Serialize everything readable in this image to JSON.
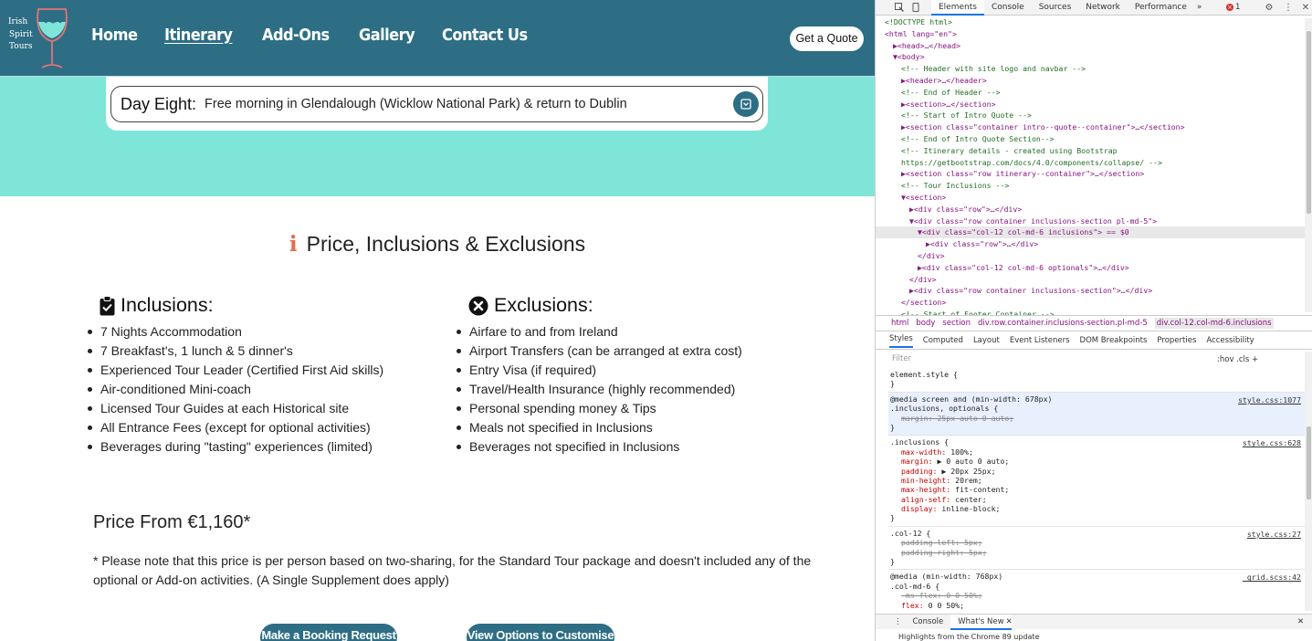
{
  "site": {
    "logo": {
      "line1": "Irish",
      "line2": "Spirit",
      "line3": "Tours"
    },
    "nav": [
      "Home",
      "Itinerary",
      "Add-Ons",
      "Gallery",
      "Contact Us"
    ],
    "quote_button": "Get a Quote",
    "day": {
      "title": "Day Eight:",
      "text": "Free morning in Glendalough (Wicklow National Park) & return to Dublin"
    },
    "section_title": "Price, Inclusions & Exclusions",
    "section_icon": "info-icon",
    "inclusions": {
      "heading": "Inclusions:",
      "icon": "clipboard-check-icon",
      "items": [
        "7 Nights Accommodation",
        "7 Breakfast's, 1 lunch & 5 dinner's",
        "Experienced Tour Leader (Certified First Aid skills)",
        "Air-conditioned Mini-coach",
        "Licensed Tour Guides at each Historical site",
        "All Entrance Fees (except for optional activities)",
        "Beverages during \"tasting\" experiences (limited)"
      ]
    },
    "exclusions": {
      "heading": "Exclusions:",
      "icon": "times-circle-icon",
      "items": [
        "Airfare to and from Ireland",
        "Airport Transfers (can be arranged at extra cost)",
        "Entry Visa (if required)",
        "Travel/Health Insurance (highly recommended)",
        "Personal spending money & Tips",
        "Meals not specified in Inclusions",
        "Beverages not specified in Inclusions"
      ]
    },
    "price": {
      "label": "Price From ",
      "amount": "€1,160*"
    },
    "price_note": "* Please note that this price is per person based on two-sharing, for the Standard Tour package and doesn't included any of the optional or Add-on activities. (A Single Supplement does apply)",
    "cta": [
      "Make a Booking Request",
      "View Options to Customise"
    ],
    "colors": {
      "header": "#2d6e85",
      "band": "#7fe5d8",
      "accent": "#e96a4b"
    }
  },
  "devtools": {
    "tabs": [
      "Elements",
      "Console",
      "Sources",
      "Network",
      "Performance"
    ],
    "more": "»",
    "error_count": "1",
    "dom_lines": [
      {
        "t": "<!DOCTYPE html>",
        "k": "cm",
        "i": 0
      },
      {
        "t": "<html lang=\"en\">",
        "k": "tag",
        "i": 0
      },
      {
        "t": "▶<head>…</head>",
        "k": "tag",
        "i": 1
      },
      {
        "t": "▼<body>",
        "k": "tag",
        "i": 1
      },
      {
        "t": "<!-- Header with site logo and navbar -->",
        "k": "cm",
        "i": 2
      },
      {
        "t": "▶<header>…</header>",
        "k": "tag",
        "i": 2
      },
      {
        "t": "<!-- End of Header -->",
        "k": "cm",
        "i": 2
      },
      {
        "t": "▶<section>…</section>",
        "k": "tag",
        "i": 2
      },
      {
        "t": "<!-- Start of Intro Quote  -->",
        "k": "cm",
        "i": 2
      },
      {
        "t": "▶<section class=\"container intro--quote--container\">…</section>",
        "k": "tag",
        "i": 2
      },
      {
        "t": "<!-- End of Intro Quote Section-->",
        "k": "cm",
        "i": 2
      },
      {
        "t": "<!-- Itinerary details - created using Bootstrap",
        "k": "cm",
        "i": 2
      },
      {
        "t": "https://getbootstrap.com/docs/4.0/components/collapse/ -->",
        "k": "cm",
        "i": 2
      },
      {
        "t": "▶<section class=\"row itinerary--container\">…</section>",
        "k": "tag",
        "i": 2
      },
      {
        "t": "<!-- Tour Inclusions -->",
        "k": "cm",
        "i": 2
      },
      {
        "t": "▼<section>",
        "k": "tag",
        "i": 2
      },
      {
        "t": "▶<div class=\"row\">…</div>",
        "k": "tag",
        "i": 3
      },
      {
        "t": "▼<div class=\"row container inclusions-section pl-md-5\">",
        "k": "tag",
        "i": 3
      },
      {
        "t": "▼<div class=\"col-12 col-md-6 inclusions\"> == $0",
        "k": "tag",
        "i": 4,
        "sel": true
      },
      {
        "t": "▶<div class=\"row\">…</div>",
        "k": "tag",
        "i": 5
      },
      {
        "t": "</div>",
        "k": "tag",
        "i": 4
      },
      {
        "t": "▶<div class=\"col-12 col-md-6 optionals\">…</div>",
        "k": "tag",
        "i": 4
      },
      {
        "t": "</div>",
        "k": "tag",
        "i": 3
      },
      {
        "t": "▶<div class=\"row container inclusions-section\">…</div>",
        "k": "tag",
        "i": 3
      },
      {
        "t": "</section>",
        "k": "tag",
        "i": 2
      },
      {
        "t": "<!-- Start of Footer Container -->",
        "k": "cm",
        "i": 2
      }
    ],
    "breadcrumbs": [
      "html",
      "body",
      "section",
      "div.row.container.inclusions-section.pl-md-5",
      "div.col-12.col-md-6.inclusions"
    ],
    "sub_tabs": [
      "Styles",
      "Computed",
      "Layout",
      "Event Listeners",
      "DOM Breakpoints",
      "Properties",
      "Accessibility"
    ],
    "filter_placeholder": "Filter",
    "filter_tools": ":hov  .cls  +",
    "styles": [
      {
        "lines": [
          "element.style {",
          "}"
        ],
        "src": ""
      },
      {
        "lines": [
          "@media screen and (min-width: 678px)",
          ".inclusions, optionals {",
          "  margin: 25px auto 0 auto;",
          "}"
        ],
        "src": "style.css:1077",
        "hl": true,
        "struck": [
          2
        ]
      },
      {
        "lines": [
          ".inclusions {",
          "  max-width: 100%;",
          "  margin: ▶ 0 auto 0 auto;",
          "  padding: ▶ 20px 25px;",
          "  min-height: 20rem;",
          "  max-height: fit-content;",
          "  align-self: center;",
          "  display: inline-block;",
          "}"
        ],
        "src": "style.css:628"
      },
      {
        "lines": [
          ".col-12 {",
          "  padding-left: 5px;",
          "  padding-right: 5px;",
          "}"
        ],
        "src": "style.css:27",
        "struck": [
          1,
          2
        ]
      },
      {
        "lines": [
          "@media (min-width: 768px)",
          ".col-md-6 {",
          "  -ms-flex: 0 0 50%;",
          "  flex: 0 0 50%;"
        ],
        "src": "_grid.scss:42",
        "struck": [
          2
        ]
      }
    ],
    "drawer_tabs": [
      "Console",
      "What's New"
    ],
    "drawer_line": "Highlights from the Chrome 89 update"
  }
}
